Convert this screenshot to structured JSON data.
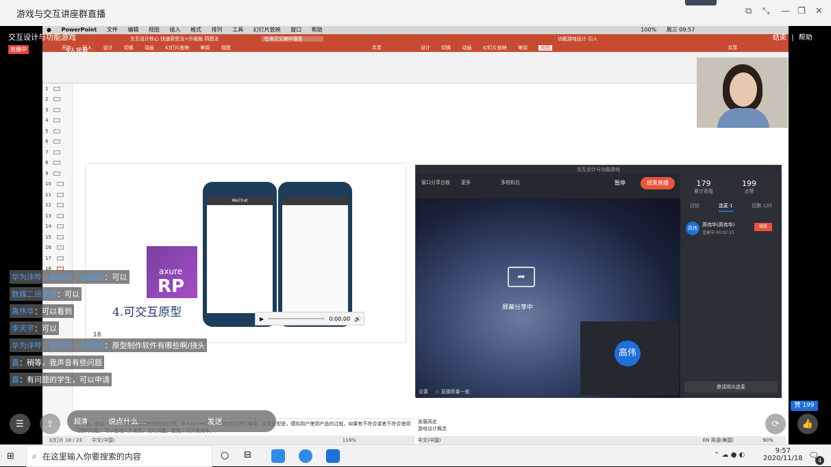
{
  "window": {
    "title": "游戏与交互讲座群直播"
  },
  "overlay": {
    "room_title": "交互设计与功能游戏",
    "live_badge": "直播中",
    "viewers": "9人观看",
    "end_label": "结束",
    "help_label": "帮助",
    "likes": "赞 199"
  },
  "mac_menu": [
    "PowerPoint",
    "文件",
    "编辑",
    "视图",
    "插入",
    "格式",
    "排列",
    "工具",
    "幻灯片放映",
    "窗口",
    "帮助"
  ],
  "ppt_left": {
    "doc_title": "交互设计核心 快速原型法+升级版 四图法",
    "search_placeholder": "在演示文稿中搜索",
    "tabs": [
      "开始",
      "插入",
      "设计",
      "切换",
      "动画",
      "幻灯片放映",
      "审阅",
      "视图"
    ],
    "share": "共享",
    "slide_numbers": [
      "1",
      "2",
      "3",
      "4",
      "5",
      "6",
      "7",
      "8",
      "9",
      "10",
      "11",
      "12",
      "13",
      "14",
      "15",
      "16",
      "17",
      "18"
    ],
    "slide_caption": "4.可交互原型",
    "slide_page": "18",
    "axure_text": "axure",
    "rp_text": "RP",
    "video_time": "0:00.00",
    "phone_app": "WeChat",
    "notes_text": "接下来，是这一步，将我们的静态的线框设计图，导入Axure中，对相应交互进行编译。交互原型是，模拟用户使用产品的过程，如果有不符合或者不符合使用习惯的功能，可以在进入开发前，及时调整，避免二次开发成本。",
    "status_left": "幻灯片 18 / 23",
    "status_lang": "中文(中国)",
    "zoom": "116%"
  },
  "ppt_right": {
    "doc_title": "功能游戏设计.引入",
    "tabs": [
      "设计",
      "切换",
      "动画",
      "幻灯片放映",
      "审阅",
      "视图"
    ],
    "share": "共享",
    "notes_lines": [
      "发展简史",
      "游戏设计概念"
    ],
    "status_lang": "中文(中国)",
    "zoom": "90%"
  },
  "live_panel": {
    "title": "交互设计与功能游戏",
    "pause": "暂停",
    "end_live": "结束直播",
    "tools": [
      "窗口分享",
      "白板",
      "更多",
      "多相机位"
    ],
    "stats": [
      {
        "value": "179",
        "label": "累计观看"
      },
      {
        "value": "199",
        "label": "点赞"
      }
    ],
    "tabs": [
      "讨论",
      "连麦·1",
      "旧数 135"
    ],
    "guest_name": "高伟华(高伟华)",
    "guest_status": "连麦中 00:02:15",
    "guest_avatar": "高伟",
    "hangup": "结束",
    "sharing": "屏幕分享中",
    "big_avatar": "高伟",
    "invite": "邀请观众连麦",
    "settings": "设置",
    "quality": "直播质量一般"
  },
  "chat": [
    {
      "name": "华为沣哔，我说的 一郜瑞峰",
      "text": "可以"
    },
    {
      "name": "数媒二班姜雪",
      "text": "可以"
    },
    {
      "name": "高伟华",
      "text": "可以看到"
    },
    {
      "name": "李天宇",
      "text": "可以"
    },
    {
      "name": "华为沣哔，我说的 一郜瑞峰",
      "text": "原型制作软件有哪些啊/挠头"
    },
    {
      "name": "嘉",
      "text": "稍等，我声音有些问题"
    },
    {
      "name": "嘉",
      "text": "有问题的学生，可以申请"
    }
  ],
  "bottom_bar": {
    "say": "说点什么...",
    "send": "发送",
    "clear": "超清"
  },
  "taskbar": {
    "search_placeholder": "在这里输入你要搜索的内容",
    "ime": "EN 英语(美国)",
    "time": "9:57",
    "date": "2020/11/18",
    "notif": "4"
  },
  "macbar_right": {
    "clock": "周三 09:57",
    "battery": "100%"
  }
}
